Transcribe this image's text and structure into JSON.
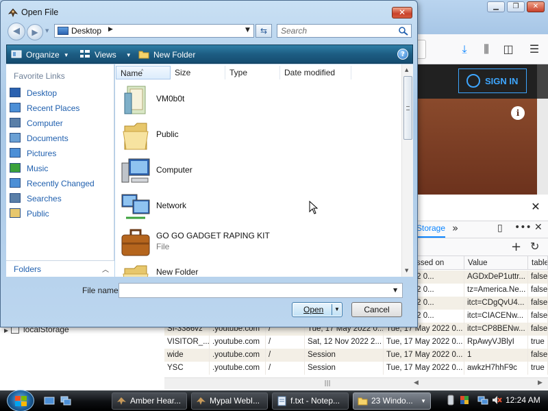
{
  "dialog": {
    "title": "Open File",
    "address": "Desktop",
    "search_placeholder": "Search",
    "toolbar": {
      "organize": "Organize",
      "views": "Views",
      "new_folder": "New Folder"
    },
    "favorites_heading": "Favorite Links",
    "favorites": [
      "Desktop",
      "Recent Places",
      "Computer",
      "Documents",
      "Pictures",
      "Music",
      "Recently Changed",
      "Searches",
      "Public"
    ],
    "folders_label": "Folders",
    "columns": [
      "Name",
      "Size",
      "Type",
      "Date modified"
    ],
    "files": [
      {
        "name": "VM0b0t",
        "sub": ""
      },
      {
        "name": "Public",
        "sub": ""
      },
      {
        "name": "Computer",
        "sub": ""
      },
      {
        "name": "Network",
        "sub": ""
      },
      {
        "name": "GO GO GADGET RAPING KIT",
        "sub": "File"
      },
      {
        "name": "New Folder",
        "sub": ""
      }
    ],
    "file_name_label": "File name:",
    "file_name_value": "",
    "open_label": "Open",
    "cancel_label": "Cancel"
  },
  "browser": {
    "signin": "SIGN IN",
    "storage_tab": "Storage",
    "sidebar_item": "localStorage",
    "columns": [
      "ssed on",
      "Value",
      "table"
    ],
    "rows": [
      {
        "name": "",
        "domain": "",
        "path": "",
        "expires": "",
        "accessed": "May 2022 0...",
        "value": "AGDxDeP1uttr...",
        "flag": "false"
      },
      {
        "name": "",
        "domain": "",
        "path": "",
        "expires": "",
        "accessed": "May 2022 0...",
        "value": "tz=America.Ne...",
        "flag": "false"
      },
      {
        "name": "",
        "domain": "",
        "path": "",
        "expires": "",
        "accessed": "May 2022 0...",
        "value": "itct=CDgQvU4...",
        "flag": "false"
      },
      {
        "name": "",
        "domain": "",
        "path": "",
        "expires": "",
        "accessed": "May 2022 0...",
        "value": "itct=CIACENw...",
        "flag": "false"
      },
      {
        "name": "SI-3386vz",
        "domain": ".youtube.com",
        "path": "/",
        "expires": "Tue, 17 May 2022 0...",
        "accessed": "Tue, 17 May 2022 0...",
        "value": "itct=CP8BENw...",
        "flag": "false"
      },
      {
        "name": "VISITOR_...",
        "domain": ".youtube.com",
        "path": "/",
        "expires": "Sat, 12 Nov 2022 2...",
        "accessed": "Tue, 17 May 2022 0...",
        "value": "RpAwyVJBlyI",
        "flag": "true"
      },
      {
        "name": "wide",
        "domain": ".youtube.com",
        "path": "/",
        "expires": "Session",
        "accessed": "Tue, 17 May 2022 0...",
        "value": "1",
        "flag": "false"
      },
      {
        "name": "YSC",
        "domain": ".youtube.com",
        "path": "/",
        "expires": "Session",
        "accessed": "Tue, 17 May 2022 0...",
        "value": "awkzH7hhF9c",
        "flag": "true"
      }
    ]
  },
  "taskbar": {
    "tasks": [
      "Amber Hear...",
      "Mypal WebI...",
      "f.txt - Notep...",
      "23 Windo..."
    ],
    "clock": "12:24 AM"
  },
  "colors": {
    "titlebar": "#a9c8e6",
    "command_bar": "#1d5d83",
    "link": "#1f5fae",
    "storage_tab": "#0a84ff",
    "signin": "#3ea6ff"
  }
}
